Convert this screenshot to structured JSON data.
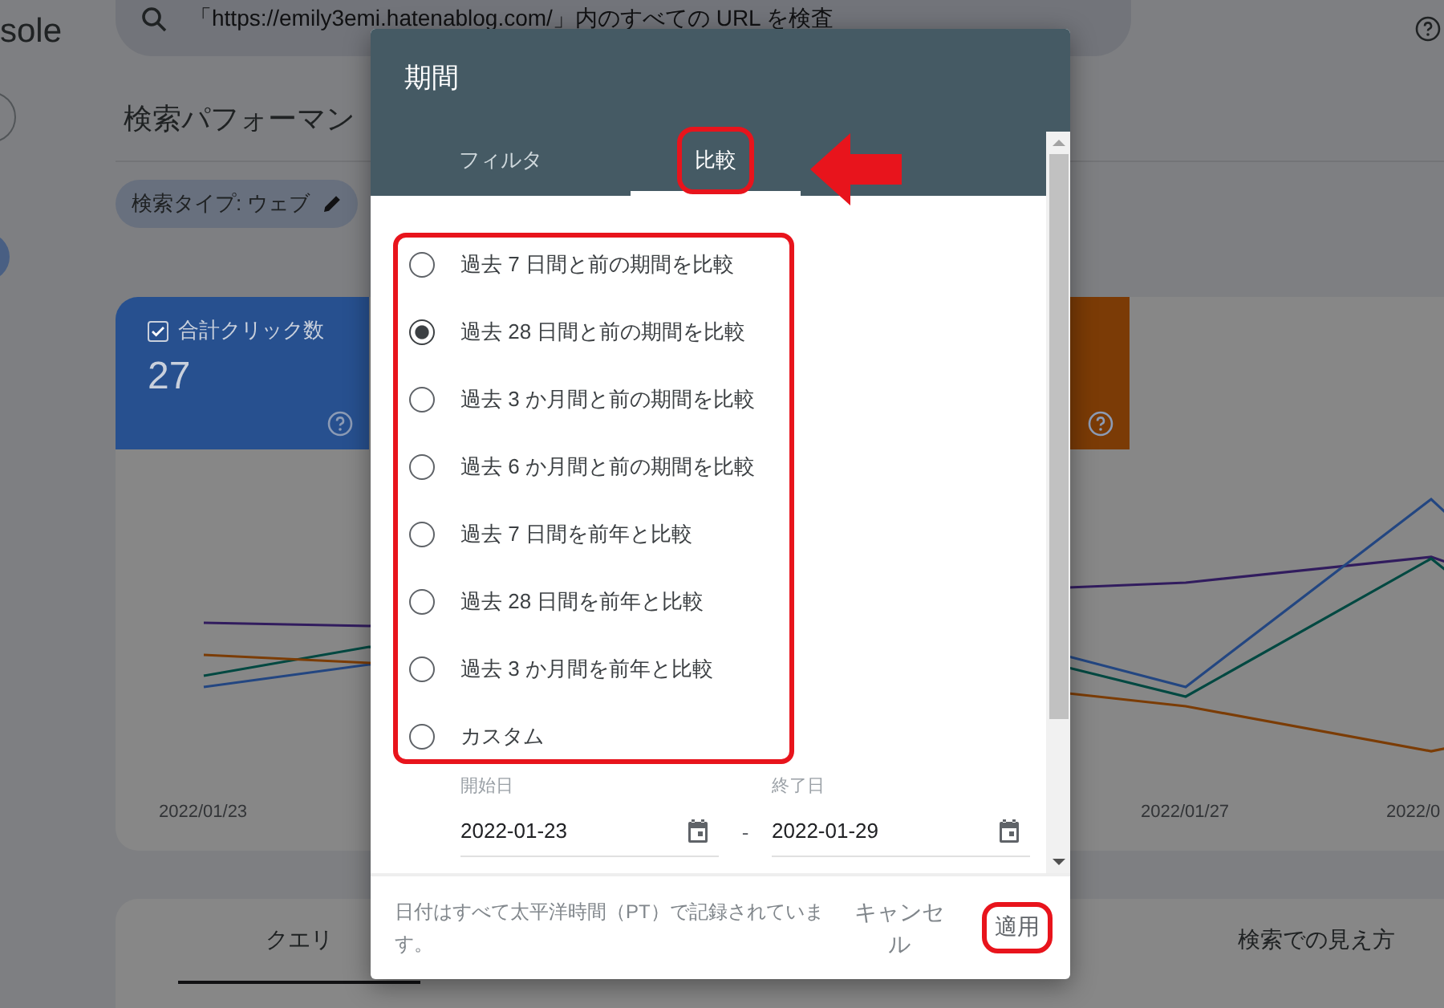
{
  "header": {
    "product_name": "sole",
    "search_placeholder": "「https://emily3emi.hatenablog.com/」内のすべての URL を検査"
  },
  "page_title": "検索パフォーマン",
  "filter_chip": {
    "label": "検索タイプ: ウェブ"
  },
  "metric_cards": [
    {
      "label": "合計クリック数",
      "value": "27",
      "checked": true,
      "color": "#27508f"
    },
    {
      "color": "#7b3b06"
    }
  ],
  "chart": {
    "x_labels": [
      "2022/01/23",
      "2022/01/27",
      "2022/0"
    ]
  },
  "bottom_tabs": [
    {
      "label": "クエリ",
      "selected": true
    },
    {
      "label": "検索での見え方",
      "selected": false
    }
  ],
  "dialog": {
    "title": "期間",
    "tabs": [
      {
        "label": "フィルタ",
        "selected": false
      },
      {
        "label": "比較",
        "selected": true
      }
    ],
    "options": [
      {
        "label": "過去 7 日間と前の期間を比較",
        "selected": false
      },
      {
        "label": "過去 28 日間と前の期間を比較",
        "selected": true
      },
      {
        "label": "過去 3 か月間と前の期間を比較",
        "selected": false
      },
      {
        "label": "過去 6 か月間と前の期間を比較",
        "selected": false
      },
      {
        "label": "過去 7 日間を前年と比較",
        "selected": false
      },
      {
        "label": "過去 28 日間を前年と比較",
        "selected": false
      },
      {
        "label": "過去 3 か月間を前年と比較",
        "selected": false
      },
      {
        "label": "カスタム",
        "selected": false
      }
    ],
    "start_date": {
      "label": "開始日",
      "value": "2022-01-23"
    },
    "separator": "-",
    "end_date": {
      "label": "終了日",
      "value": "2022-01-29"
    },
    "footnote": "日付はすべて太平洋時間（PT）で記録されています。",
    "cancel": "キャンセル",
    "apply": "適用"
  }
}
